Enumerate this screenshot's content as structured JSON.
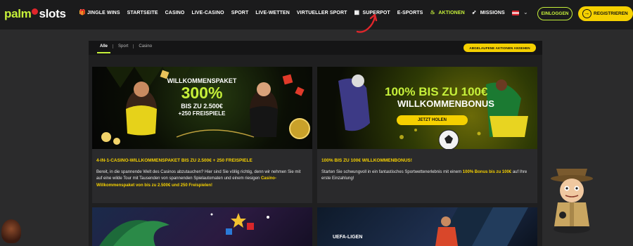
{
  "brand": {
    "logo_part1": "palm",
    "logo_part2": "slots"
  },
  "nav": {
    "items": [
      {
        "label": "JINGLE WINS",
        "icon": "gift-icon"
      },
      {
        "label": "STARTSEITE"
      },
      {
        "label": "CASINO"
      },
      {
        "label": "LIVE-CASINO"
      },
      {
        "label": "SPORT"
      },
      {
        "label": "LIVE-WETTEN"
      },
      {
        "label": "VIRTUELLER SPORT"
      },
      {
        "label": "SUPERPOT",
        "icon": "jackpot-icon"
      },
      {
        "label": "E-SPORTS"
      },
      {
        "label": "AKTIONEN",
        "icon": "fire-icon",
        "active": true
      },
      {
        "label": "MISSIONS",
        "icon": "rocket-icon"
      }
    ]
  },
  "header": {
    "login_label": "EINLOGGEN",
    "register_label": "REGISTRIEREN",
    "language_flag": "austria-flag"
  },
  "filters": {
    "tabs": [
      {
        "label": "Alle",
        "active": true
      },
      {
        "label": "Sport"
      },
      {
        "label": "Casino"
      }
    ],
    "expired_button_label": "ABGELAUFENE AKTIONEN ANSEHEN"
  },
  "cards": [
    {
      "banner": {
        "line1": "WILLKOMMENSPAKET",
        "line2": "300%",
        "line3": "BIS ZU 2.500€",
        "line4": "+250 FREISPIELE"
      },
      "title": "4-IN-1-CASINO-WILLKOMMENSPAKET BIS ZU 2.500€ + 250 FREISPIELE",
      "text_plain": "Bereit, in die spannende Welt des Casinos abzutauchen? Hier sind Sie völlig richtig, denn wir nehmen Sie mit auf eine wilde Tour mit Tausenden von spannenden Spielautomaten und einem riesigen ",
      "text_highlight": "Casino-Willkommenspaket von bis zu 2.500€ und 250 Freispielen!"
    },
    {
      "banner": {
        "line1": "100% BIS ZU 100€",
        "line2": "WILLKOMMENBONUS",
        "cta": "JETZT HOLEN"
      },
      "title": "100% BIS ZU 100€ WILLKOMMENBONUS!",
      "text_plain": "Starten Sie schwungvoll in ein fantastisches Sportwettenerlebnis mit einem ",
      "text_highlight": "100% Bonus bis zu 100€",
      "text_tail": " auf Ihre erste Einzahlung!"
    },
    {
      "banner_text": ""
    },
    {
      "banner_text": "UEFA-LIGEN"
    }
  ],
  "colors": {
    "accent_green": "#c6f03a",
    "accent_yellow": "#f5d000",
    "background": "#2b2b2c",
    "panel": "#1f1f20",
    "annotation_red": "#e0262b"
  }
}
